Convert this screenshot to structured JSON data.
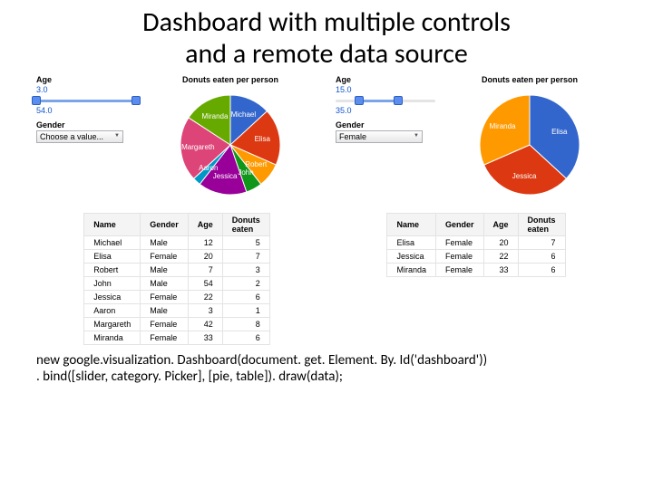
{
  "title_line1": "Dashboard with multiple controls",
  "title_line2": "and a remote data source",
  "labels": {
    "age": "Age",
    "gender": "Gender"
  },
  "dashboard_left": {
    "slider": {
      "min_shown": "3.0",
      "max_shown": "54.0",
      "fill_left_pct": 0,
      "fill_right_pct": 100
    },
    "select_value": "Choose a value...",
    "pie_title": "Donuts eaten per person",
    "table": {
      "headers": [
        "Name",
        "Gender",
        "Age",
        "Donuts eaten"
      ],
      "rows": [
        [
          "Michael",
          "Male",
          "12",
          "5"
        ],
        [
          "Elisa",
          "Female",
          "20",
          "7"
        ],
        [
          "Robert",
          "Male",
          "7",
          "3"
        ],
        [
          "John",
          "Male",
          "54",
          "2"
        ],
        [
          "Jessica",
          "Female",
          "22",
          "6"
        ],
        [
          "Aaron",
          "Male",
          "3",
          "1"
        ],
        [
          "Margareth",
          "Female",
          "42",
          "8"
        ],
        [
          "Miranda",
          "Female",
          "33",
          "6"
        ]
      ]
    }
  },
  "dashboard_right": {
    "slider": {
      "min_shown": "15.0",
      "max_shown": "35.0",
      "fill_left_pct": 24,
      "fill_right_pct": 63
    },
    "select_value": "Female",
    "pie_title": "Donuts eaten per person",
    "table": {
      "headers": [
        "Name",
        "Gender",
        "Age",
        "Donuts eaten"
      ],
      "rows": [
        [
          "Elisa",
          "Female",
          "20",
          "7"
        ],
        [
          "Jessica",
          "Female",
          "22",
          "6"
        ],
        [
          "Miranda",
          "Female",
          "33",
          "6"
        ]
      ]
    }
  },
  "code_line1": "new google.visualization. Dashboard(document. get. Element. By. Id('dashboard'))",
  "code_line2": ". bind([slider, category. Picker], [pie, table]). draw(data);",
  "chart_data": [
    {
      "type": "pie",
      "title": "Donuts eaten per person",
      "series": [
        {
          "name": "Michael",
          "value": 5,
          "color": "#3366CC"
        },
        {
          "name": "Elisa",
          "value": 7,
          "color": "#DC3912"
        },
        {
          "name": "Robert",
          "value": 3,
          "color": "#FF9900"
        },
        {
          "name": "John",
          "value": 2,
          "color": "#109618"
        },
        {
          "name": "Jessica",
          "value": 6,
          "color": "#990099"
        },
        {
          "name": "Aaron",
          "value": 1,
          "color": "#0099C6"
        },
        {
          "name": "Margareth",
          "value": 8,
          "color": "#DD4477"
        },
        {
          "name": "Miranda",
          "value": 6,
          "color": "#66AA00"
        }
      ]
    },
    {
      "type": "pie",
      "title": "Donuts eaten per person",
      "series": [
        {
          "name": "Elisa",
          "value": 7,
          "color": "#3366CC"
        },
        {
          "name": "Jessica",
          "value": 6,
          "color": "#DC3912"
        },
        {
          "name": "Miranda",
          "value": 6,
          "color": "#FF9900"
        }
      ]
    }
  ]
}
